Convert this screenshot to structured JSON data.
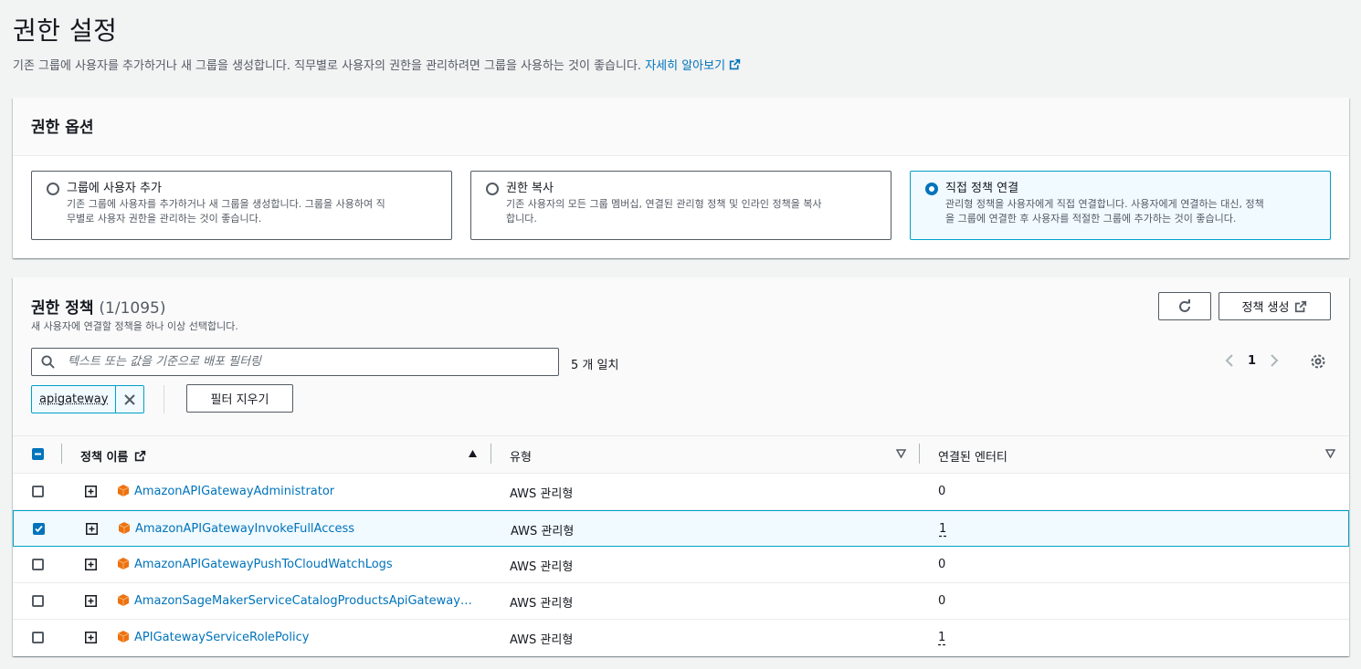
{
  "page": {
    "title": "권한 설정",
    "description": "기존 그룹에 사용자를 추가하거나 새 그룹을 생성합니다. 직무별로 사용자의 권한을 관리하려면 그룹을 사용하는 것이 좋습니다.",
    "learn_more": "자세히 알아보기"
  },
  "options": {
    "header": "권한 옵션",
    "items": [
      {
        "title": "그룹에 사용자 추가",
        "desc_line1": "기존 그룹에 사용자를 추가하거나 새 그룹을 생성합니다. 그룹을 사용하여 직",
        "desc_line2": "무별로 사용자 권한을 관리하는 것이 좋습니다.",
        "selected": false
      },
      {
        "title": "권한 복사",
        "desc_line1": "기존 사용자의 모든 그룹 멤버십, 연결된 관리형 정책 및 인라인 정책을 복사",
        "desc_line2": "합니다.",
        "selected": false
      },
      {
        "title": "직접 정책 연결",
        "desc_line1": "관리형 정책을 사용자에게 직접 연결합니다. 사용자에게 연결하는 대신, 정책",
        "desc_line2": "을 그룹에 연결한 후 사용자를 적절한 그룹에 추가하는 것이 좋습니다.",
        "selected": true
      }
    ]
  },
  "policies": {
    "title": "권한 정책",
    "count": "(1/1095)",
    "subtitle": "새 사용자에 연결할 정책을 하나 이상 선택합니다.",
    "create_button": "정책 생성",
    "search_placeholder": "텍스트 또는 값을 기준으로 배포 필터링",
    "match_text": "5 개 일치",
    "page": "1",
    "filter_token": "apigateway",
    "clear_filters": "필터 지우기",
    "columns": {
      "name": "정책 이름",
      "type": "유형",
      "entities": "연결된 엔터티"
    },
    "rows": [
      {
        "name": "AmazonAPIGatewayAdministrator",
        "type": "AWS 관리형",
        "entities": "0",
        "checked": false
      },
      {
        "name": "AmazonAPIGatewayInvokeFullAccess",
        "type": "AWS 관리형",
        "entities": "1",
        "checked": true
      },
      {
        "name": "AmazonAPIGatewayPushToCloudWatchLogs",
        "type": "AWS 관리형",
        "entities": "0",
        "checked": false
      },
      {
        "name": "AmazonSageMakerServiceCatalogProductsApiGatewayServiceRolePolicy",
        "type": "AWS 관리형",
        "entities": "0",
        "checked": false
      },
      {
        "name": "APIGatewayServiceRolePolicy",
        "type": "AWS 관리형",
        "entities": "1",
        "checked": false
      }
    ]
  },
  "colors": {
    "accent": "#0073bb",
    "selected_border": "#00a1c9",
    "selected_bg": "#f1faff",
    "package_icon": "#ec7211"
  }
}
